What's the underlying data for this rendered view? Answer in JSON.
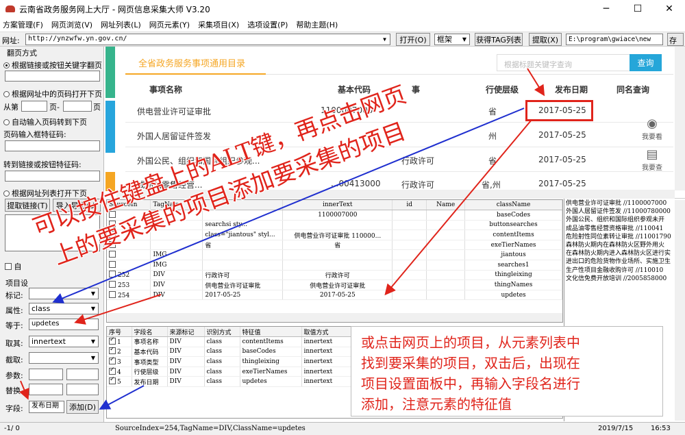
{
  "window": {
    "title": "云南省政务服务网上大厅 - 网页信息采集大师 V3.20"
  },
  "menu": [
    "方案管理(F)",
    "网页浏览(V)",
    "网址列表(L)",
    "网页元素(Y)",
    "采集项目(X)",
    "选项设置(P)",
    "帮助主题(H)"
  ],
  "toolbar": {
    "addr_label": "网址:",
    "url": "http://ynzwfw.yn.gov.cn/",
    "open_label": "打开(O)",
    "frame_value": "框架",
    "get_tags_label": "获得TAG列表",
    "extract_label": "提取(X)",
    "path": "E:\\program\\gwiace\\new",
    "save_label": "保存(S)"
  },
  "left": {
    "section_title": "翻页方式",
    "opt1": "根据链接或按钮关键字翻页",
    "opt2": "根据网址中的页码打开下页",
    "from_label": "从第",
    "page_sep": "页-",
    "page_end": "页",
    "opt3": "自动输入页码转到下页",
    "page_input_label": "页码输入框特征码:",
    "goto_label": "转到链接或按钮特征码:",
    "opt4": "根据网址列表打开下页",
    "extract_link": "提取链接(T)",
    "import_export": "导入导出(U)",
    "auto_check": "自",
    "item_settings": "项目设",
    "mark_label": "标记:",
    "attr_label": "属性:",
    "attr_value": "class",
    "equals_label": "等于:",
    "equals_value": "updetes",
    "take_label": "取其:",
    "take_value": "innertext",
    "cut_label": "截取:",
    "param_label": "参数:",
    "replace_label": "替换",
    "field_label": "字段:",
    "field_value": "发布日期",
    "add_label": "添加(D)"
  },
  "web": {
    "title": "全省政务服务事项通用目录",
    "search_placeholder": "根据标题关键字查询",
    "search_btn": "查询",
    "headers": [
      "事项名称",
      "基本代码",
      "事",
      "行使层级",
      "发布日期",
      "同名查询"
    ],
    "rows": [
      {
        "name": "供电营业许可证审批",
        "code": "1100007000",
        "type": "",
        "level": "省",
        "date": "2017-05-25"
      },
      {
        "name": "外国人居留证件签发",
        "code": "",
        "type": "",
        "level": "州",
        "date": "2017-05-25"
      },
      {
        "name": "外国公民、组织和国际组织参观...",
        "code": "",
        "type": "行政许可",
        "level": "省",
        "date": "2017-05-25"
      },
      {
        "name": "成品油零售经营...",
        "code": "...00413000",
        "type": "行政许可",
        "level": "省,州",
        "date": "2017-05-25"
      }
    ],
    "icon1_label": "我要看",
    "icon2_label": "我要查"
  },
  "elements": {
    "headers": [
      "SourceIn",
      "TagName",
      "",
      "innerText",
      "id",
      "Name",
      "className"
    ],
    "rows": [
      {
        "chk": false,
        "idx": "",
        "tag": "",
        "a": "",
        "text": "1100007000",
        "id": "",
        "name": "",
        "cls": "baseCodes"
      },
      {
        "chk": false,
        "idx": "",
        "tag": "",
        "a": "searchsi sty...",
        "text": "",
        "id": "",
        "name": "",
        "cls": "buttonsearches"
      },
      {
        "chk": false,
        "idx": "",
        "tag": "",
        "a": "class=\"jiantous\" styl...",
        "text": "供电营业许可证审批 110000...",
        "id": "",
        "name": "",
        "cls": "contentItems"
      },
      {
        "chk": false,
        "idx": "",
        "tag": "",
        "a": "省",
        "text": "省",
        "id": "",
        "name": "",
        "cls": "exeTierNames"
      },
      {
        "chk": false,
        "idx": "",
        "tag": "IMG",
        "a": "",
        "text": "",
        "id": "",
        "name": "",
        "cls": "jiantous"
      },
      {
        "chk": false,
        "idx": "",
        "tag": "IMG",
        "a": "",
        "text": "",
        "id": "",
        "name": "",
        "cls": "searches1"
      },
      {
        "chk": false,
        "idx": "252",
        "tag": "DIV",
        "a": "行政许可",
        "text": "行政许可",
        "id": "",
        "name": "",
        "cls": "thingleixing"
      },
      {
        "chk": false,
        "idx": "253",
        "tag": "DIV",
        "a": "供电营业许可证审批",
        "text": "供电营业许可证审批",
        "id": "",
        "name": "",
        "cls": "thingNames"
      },
      {
        "chk": false,
        "idx": "254",
        "tag": "DIV",
        "a": "2017-05-25",
        "text": "2017-05-25",
        "id": "",
        "name": "",
        "cls": "updetes"
      }
    ]
  },
  "items": {
    "headers": [
      "序号",
      "字段名",
      "来源标记",
      "识别方式",
      "特征值",
      "取值方式"
    ],
    "rows": [
      {
        "n": "1",
        "field": "事项名称",
        "src": "DIV",
        "mode": "class",
        "val": "contentItems",
        "take": "innertext"
      },
      {
        "n": "2",
        "field": "基本代码",
        "src": "DIV",
        "mode": "class",
        "val": "baseCodes",
        "take": "innertext"
      },
      {
        "n": "3",
        "field": "事项类型",
        "src": "DIV",
        "mode": "class",
        "val": "thingleixing",
        "take": "innertext"
      },
      {
        "n": "4",
        "field": "行使层级",
        "src": "DIV",
        "mode": "class",
        "val": "exeTierNames",
        "take": "innertext"
      },
      {
        "n": "5",
        "field": "发布日期",
        "src": "DIV",
        "mode": "class",
        "val": "updetes",
        "take": "innertext"
      }
    ]
  },
  "textpane_lines": [
    "供电营业许可证审批 //1100007000",
    "外国人居留证件签发 //11000780000",
    "外国公民、组织和国际组织参观未开",
    "成品油零售经营资格审批 //110041",
    "危险射性同位素转让审批 //11001790",
    "森林防火期内在森林防火区野外用火",
    "在森林防火期内进入森林防火区进行实",
    "进出口的危险货物作业场所、实施卫生",
    "生产性项目金融收购许可 //110010",
    "文化信免费开放培训 //2005858000"
  ],
  "annotations": {
    "big_line1": "可以按住键盘上的ALT键，再点击网页",
    "big_line2": "上的要采集的项目添加要采集的项目",
    "box_lines": [
      "或点击网页上的项目，从元素列表中",
      "找到要采集的项目，双击后，出现在",
      "项目设置面板中，再输入字段名进行",
      "添加，注意元素的特征值"
    ]
  },
  "status": {
    "left": "-1/ 0",
    "middle": "SourceIndex=254,TagName=DIV,ClassName=updetes",
    "date": "2019/7/15",
    "time": "16:53"
  },
  "colors": {
    "accent_orange": "#f5a623",
    "search_blue": "#25a6d9",
    "annotation_red": "#e0241b",
    "arrow_blue": "#1f2fcf"
  }
}
